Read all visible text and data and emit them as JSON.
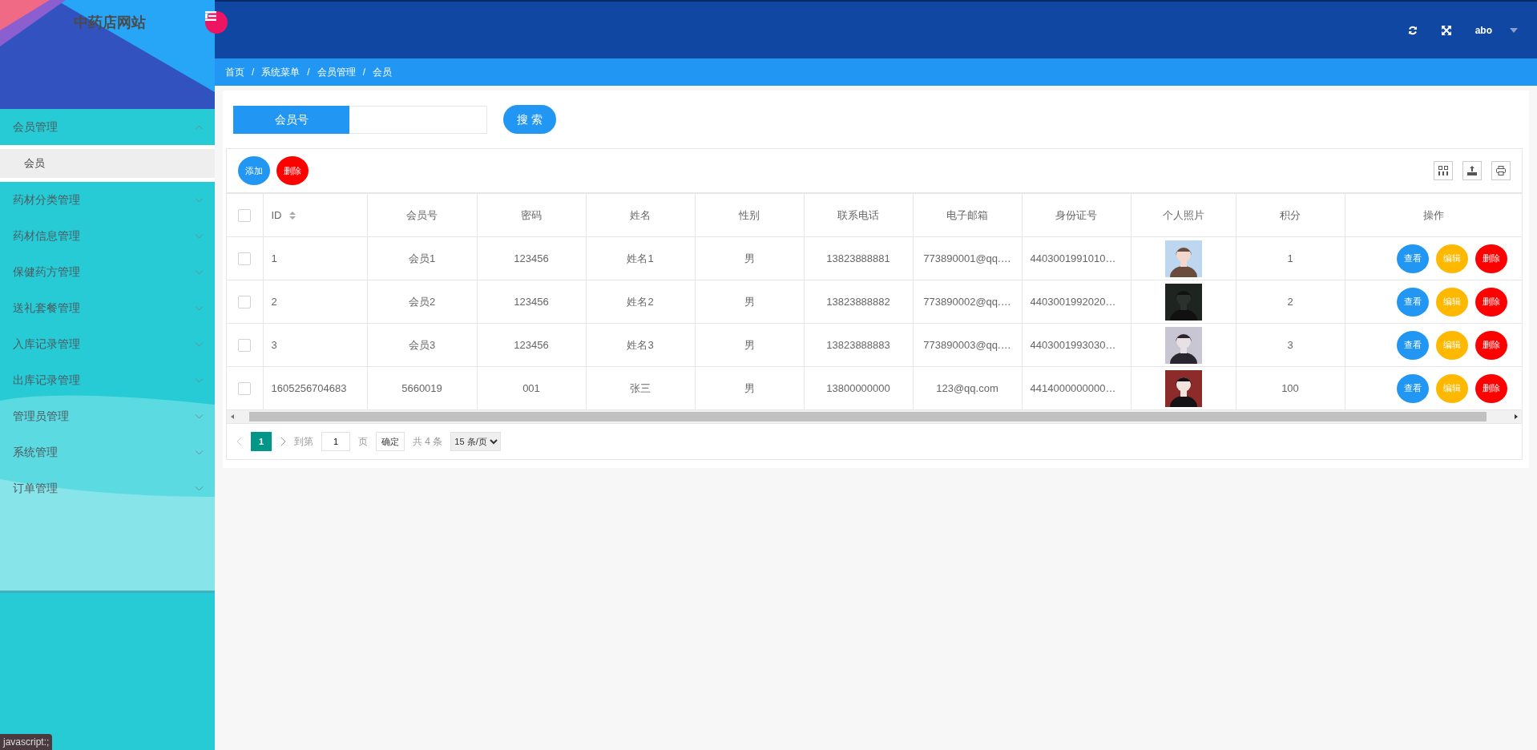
{
  "sidebar": {
    "title": "中药店网站",
    "items": [
      {
        "label": "会员管理",
        "expanded": true,
        "children": [
          {
            "label": "会员",
            "selected": true
          }
        ]
      },
      {
        "label": "药材分类管理",
        "expanded": false
      },
      {
        "label": "药材信息管理",
        "expanded": false
      },
      {
        "label": "保健药方管理",
        "expanded": false
      },
      {
        "label": "送礼套餐管理",
        "expanded": false
      },
      {
        "label": "入库记录管理",
        "expanded": false
      },
      {
        "label": "出库记录管理",
        "expanded": false
      },
      {
        "label": "管理员管理",
        "expanded": false
      },
      {
        "label": "系统管理",
        "expanded": false
      },
      {
        "label": "订单管理",
        "expanded": false
      }
    ]
  },
  "topbar": {
    "user": "abo"
  },
  "breadcrumb": [
    {
      "label": "首页"
    },
    {
      "separator": "/",
      "label": "系统菜单"
    },
    {
      "separator": "/",
      "label": "会员管理"
    },
    {
      "separator": "/",
      "label": "会员"
    }
  ],
  "search": {
    "label": "会员号",
    "button": "搜 索"
  },
  "toolbar": {
    "buttons": [
      {
        "label": "添加",
        "kind": "primary"
      },
      {
        "label": "删除",
        "kind": "danger"
      }
    ]
  },
  "table": {
    "select_all_checked": false,
    "columns": [
      "ID",
      "会员号",
      "密码",
      "姓名",
      "性别",
      "联系电话",
      "电子邮箱",
      "身份证号",
      "个人照片",
      "积分",
      "操作"
    ],
    "rows": [
      {
        "checked": false,
        "cells": [
          "1",
          "会员1",
          "123456",
          "姓名1",
          "男",
          "13823888881",
          "773890001@qq.…",
          "4403001991010…"
        ],
        "points": "1",
        "photo": {
          "kind": "picture"
        },
        "actions": [
          {
            "label": "查看",
            "kind": "view"
          },
          {
            "label": "编辑",
            "kind": "edit"
          },
          {
            "label": "删除",
            "kind": "delete"
          }
        ]
      },
      {
        "checked": false,
        "cells": [
          "2",
          "会员2",
          "123456",
          "姓名2",
          "男",
          "13823888882",
          "773890002@qq.…",
          "4403001992020…"
        ],
        "points": "2",
        "photo": {
          "kind": "picture"
        },
        "actions": [
          {
            "label": "查看",
            "kind": "view"
          },
          {
            "label": "编辑",
            "kind": "edit"
          },
          {
            "label": "删除",
            "kind": "delete"
          }
        ]
      },
      {
        "checked": false,
        "cells": [
          "3",
          "会员3",
          "123456",
          "姓名3",
          "男",
          "13823888883",
          "773890003@qq.…",
          "4403001993030…"
        ],
        "points": "3",
        "photo": {
          "kind": "picture"
        },
        "actions": [
          {
            "label": "查看",
            "kind": "view"
          },
          {
            "label": "编辑",
            "kind": "edit"
          },
          {
            "label": "删除",
            "kind": "delete"
          }
        ]
      },
      {
        "checked": false,
        "cells": [
          "1605256704683",
          "5660019",
          "001",
          "张三",
          "男",
          "13800000000",
          "123@qq.com",
          "4414000000000…"
        ],
        "points": "100",
        "photo": {
          "kind": "picture"
        },
        "actions": [
          {
            "label": "查看",
            "kind": "view"
          },
          {
            "label": "编辑",
            "kind": "edit"
          },
          {
            "label": "删除",
            "kind": "delete"
          }
        ]
      }
    ]
  },
  "pagination": {
    "pages": [
      {
        "label": "1",
        "selected": true
      }
    ],
    "goto_label": "到第",
    "goto_value": "1",
    "page_unit": "页",
    "confirm": "确定",
    "total": "共 4 条",
    "page_size": "15 条/页"
  },
  "status_bar": "javascript:;"
}
